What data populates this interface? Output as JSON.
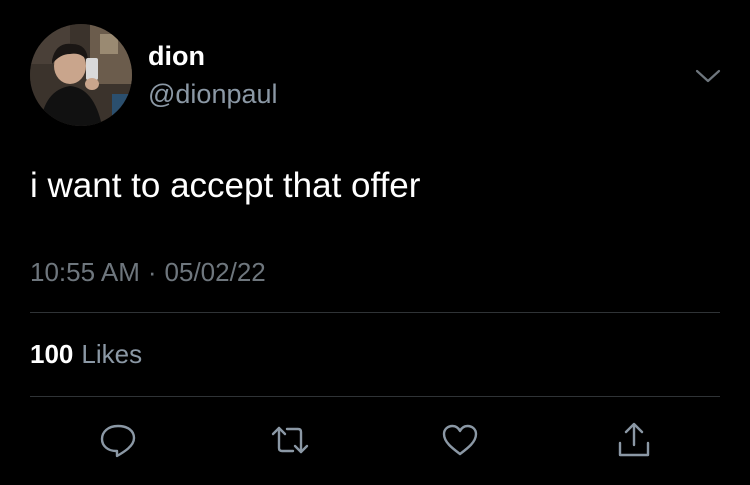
{
  "user": {
    "display_name": "dion",
    "handle": "@dionpaul",
    "avatar_icon": "profile-photo"
  },
  "tweet": {
    "text": "i want to accept that offer",
    "time": "10:55 AM",
    "separator": "·",
    "date": "05/02/22"
  },
  "stats": {
    "likes_count": "100",
    "likes_label": "Likes"
  },
  "actions": [
    {
      "name": "reply",
      "icon": "speech-bubble-icon"
    },
    {
      "name": "retweet",
      "icon": "retweet-arrows-icon"
    },
    {
      "name": "like",
      "icon": "heart-icon"
    },
    {
      "name": "share",
      "icon": "share-upload-icon"
    }
  ],
  "colors": {
    "background": "#000000",
    "primary_text": "#ffffff",
    "secondary_text": "#8b98a5",
    "divider": "#2f3336"
  }
}
